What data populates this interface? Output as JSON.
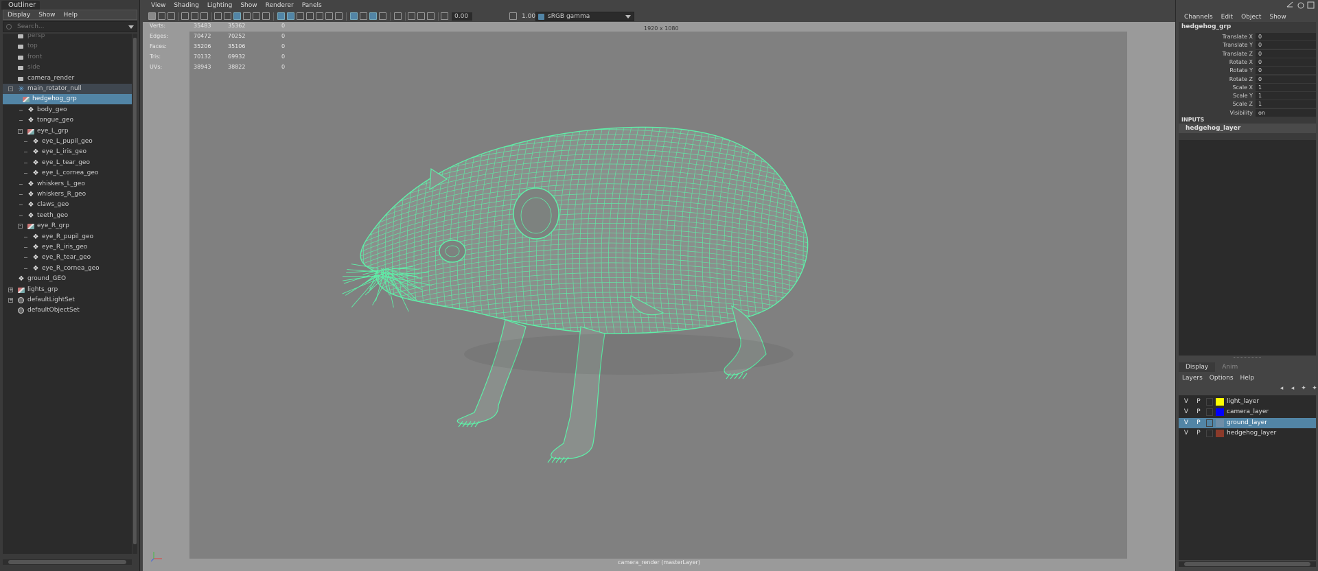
{
  "outliner": {
    "tab": "Outliner",
    "menu": [
      "Display",
      "Show",
      "Help"
    ],
    "search_placeholder": "Search...",
    "items": [
      {
        "label": "persp",
        "type": "camera",
        "depth": 1,
        "dim": true
      },
      {
        "label": "top",
        "type": "camera",
        "depth": 1,
        "dim": true
      },
      {
        "label": "front",
        "type": "camera",
        "depth": 1,
        "dim": true
      },
      {
        "label": "side",
        "type": "camera",
        "depth": 1,
        "dim": true
      },
      {
        "label": "camera_render",
        "type": "camera",
        "depth": 1
      },
      {
        "label": "main_rotator_null",
        "type": "null",
        "depth": 1,
        "expander": "-",
        "highlight": true
      },
      {
        "label": "hedgehog_grp",
        "type": "group",
        "depth": 2,
        "selected": true
      },
      {
        "label": "body_geo",
        "type": "mesh",
        "depth": 3
      },
      {
        "label": "tongue_geo",
        "type": "mesh",
        "depth": 3
      },
      {
        "label": "eye_L_grp",
        "type": "group",
        "depth": 3,
        "expander": "-"
      },
      {
        "label": "eye_L_pupil_geo",
        "type": "mesh",
        "depth": 4
      },
      {
        "label": "eye_L_iris_geo",
        "type": "mesh",
        "depth": 4
      },
      {
        "label": "eye_L_tear_geo",
        "type": "mesh",
        "depth": 4
      },
      {
        "label": "eye_L_cornea_geo",
        "type": "mesh",
        "depth": 4
      },
      {
        "label": "whiskers_L_geo",
        "type": "mesh",
        "depth": 3
      },
      {
        "label": "whiskers_R_geo",
        "type": "mesh",
        "depth": 3
      },
      {
        "label": "claws_geo",
        "type": "mesh",
        "depth": 3
      },
      {
        "label": "teeth_geo",
        "type": "mesh",
        "depth": 3
      },
      {
        "label": "eye_R_grp",
        "type": "group",
        "depth": 3,
        "expander": "-"
      },
      {
        "label": "eye_R_pupil_geo",
        "type": "mesh",
        "depth": 4
      },
      {
        "label": "eye_R_iris_geo",
        "type": "mesh",
        "depth": 4
      },
      {
        "label": "eye_R_tear_geo",
        "type": "mesh",
        "depth": 4
      },
      {
        "label": "eye_R_cornea_geo",
        "type": "mesh",
        "depth": 4
      },
      {
        "label": "ground_GEO",
        "type": "mesh",
        "depth": 1
      },
      {
        "label": "lights_grp",
        "type": "group",
        "depth": 1,
        "expander": "+"
      },
      {
        "label": "defaultLightSet",
        "type": "set",
        "depth": 1,
        "expander": "+"
      },
      {
        "label": "defaultObjectSet",
        "type": "set",
        "depth": 1
      }
    ]
  },
  "viewport": {
    "menu": [
      "View",
      "Shading",
      "Lighting",
      "Show",
      "Renderer",
      "Panels"
    ],
    "exposure": "0.00",
    "gamma": "1.00",
    "color_space": "sRGB gamma",
    "gate_size": "1920 x 1080",
    "hud": [
      {
        "label": "Verts:",
        "a": "35483",
        "b": "35362",
        "c": "0"
      },
      {
        "label": "Edges:",
        "a": "70472",
        "b": "70252",
        "c": "0"
      },
      {
        "label": "Faces:",
        "a": "35206",
        "b": "35106",
        "c": "0"
      },
      {
        "label": "Tris:",
        "a": "70132",
        "b": "69932",
        "c": "0"
      },
      {
        "label": "UVs:",
        "a": "38943",
        "b": "38822",
        "c": "0"
      }
    ],
    "camera_label": "camera_render (masterLayer)",
    "wire_color": "#5ef0a8"
  },
  "channel_box": {
    "menu": [
      "Channels",
      "Edit",
      "Object",
      "Show"
    ],
    "object": "hedgehog_grp",
    "channels": [
      {
        "label": "Translate X",
        "value": "0"
      },
      {
        "label": "Translate Y",
        "value": "0"
      },
      {
        "label": "Translate Z",
        "value": "0"
      },
      {
        "label": "Rotate X",
        "value": "0"
      },
      {
        "label": "Rotate Y",
        "value": "0"
      },
      {
        "label": "Rotate Z",
        "value": "0"
      },
      {
        "label": "Scale X",
        "value": "1"
      },
      {
        "label": "Scale Y",
        "value": "1"
      },
      {
        "label": "Scale Z",
        "value": "1"
      },
      {
        "label": "Visibility",
        "value": "on"
      }
    ],
    "inputs_header": "INPUTS",
    "input_node": "hedgehog_layer"
  },
  "layer_editor": {
    "tabs": [
      "Display",
      "Anim"
    ],
    "menu": [
      "Layers",
      "Options",
      "Help"
    ],
    "layers": [
      {
        "v": "V",
        "p": "P",
        "name": "light_layer",
        "color": "#ffff00"
      },
      {
        "v": "V",
        "p": "P",
        "name": "camera_layer",
        "color": "#0000ff"
      },
      {
        "v": "V",
        "p": "P",
        "name": "ground_layer",
        "color": "#6f8ea8",
        "selected": true
      },
      {
        "v": "V",
        "p": "P",
        "name": "hedgehog_layer",
        "color": "#8b3a2a"
      }
    ]
  }
}
